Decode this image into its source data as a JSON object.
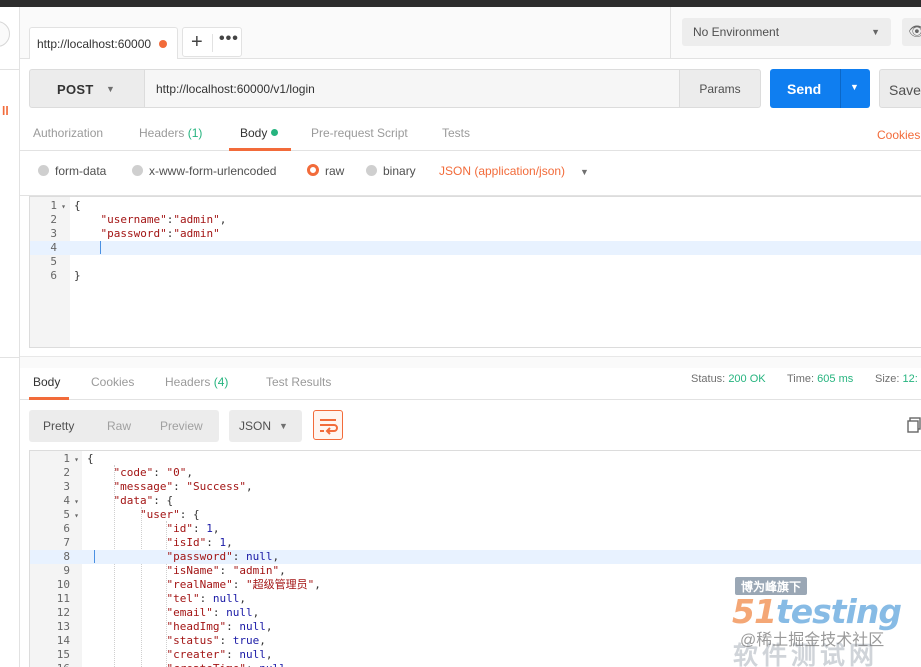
{
  "tabs": {
    "request_tab_label": "http://localhost:60000",
    "plus_label": "+",
    "more_label": "•••"
  },
  "environment": {
    "selected": "No Environment"
  },
  "request": {
    "method": "POST",
    "url": "http://localhost:60000/v1/login",
    "params_label": "Params",
    "send_label": "Send",
    "save_label": "Save"
  },
  "request_tabs": {
    "authorization": "Authorization",
    "headers": "Headers",
    "headers_count": "(1)",
    "body": "Body",
    "pre_request": "Pre-request Script",
    "tests": "Tests",
    "cookies": "Cookies"
  },
  "body_types": {
    "form_data": "form-data",
    "urlencoded": "x-www-form-urlencoded",
    "raw": "raw",
    "binary": "binary",
    "content_type": "JSON (application/json)"
  },
  "request_body_lines": [
    {
      "n": "1",
      "fold": "▾",
      "text": "{"
    },
    {
      "n": "2",
      "fold": "",
      "text": "    \"username\":\"admin\","
    },
    {
      "n": "3",
      "fold": "",
      "text": "    \"password\":\"admin\""
    },
    {
      "n": "4",
      "fold": "",
      "text": "    "
    },
    {
      "n": "5",
      "fold": "",
      "text": ""
    },
    {
      "n": "6",
      "fold": "",
      "text": "}"
    }
  ],
  "response_tabs": {
    "body": "Body",
    "cookies": "Cookies",
    "headers": "Headers",
    "headers_count": "(4)",
    "test_results": "Test Results"
  },
  "response_meta": {
    "status_label": "Status:",
    "status_value": "200 OK",
    "time_label": "Time:",
    "time_value": "605 ms",
    "size_label": "Size:",
    "size_value": "12:"
  },
  "response_toolbar": {
    "pretty": "Pretty",
    "raw": "Raw",
    "preview": "Preview",
    "format": "JSON"
  },
  "response_body_lines": [
    {
      "n": "1",
      "fold": "▾",
      "indent": 0,
      "key": "",
      "val": "",
      "raw": "{"
    },
    {
      "n": "2",
      "fold": "",
      "indent": 1,
      "key": "\"code\"",
      "val": "\"0\"",
      "tail": ","
    },
    {
      "n": "3",
      "fold": "",
      "indent": 1,
      "key": "\"message\"",
      "val": "\"Success\"",
      "tail": ","
    },
    {
      "n": "4",
      "fold": "▾",
      "indent": 1,
      "key": "\"data\"",
      "val": "",
      "tail": "{"
    },
    {
      "n": "5",
      "fold": "▾",
      "indent": 2,
      "key": "\"user\"",
      "val": "",
      "tail": "{"
    },
    {
      "n": "6",
      "fold": "",
      "indent": 3,
      "key": "\"id\"",
      "val": "1",
      "tail": ","
    },
    {
      "n": "7",
      "fold": "",
      "indent": 3,
      "key": "\"isId\"",
      "val": "1",
      "tail": ","
    },
    {
      "n": "8",
      "fold": "",
      "indent": 3,
      "key": "\"password\"",
      "val": "null",
      "tail": ","
    },
    {
      "n": "9",
      "fold": "",
      "indent": 3,
      "key": "\"isName\"",
      "val": "\"admin\"",
      "tail": ","
    },
    {
      "n": "10",
      "fold": "",
      "indent": 3,
      "key": "\"realName\"",
      "val": "\"超级管理员\"",
      "tail": ","
    },
    {
      "n": "11",
      "fold": "",
      "indent": 3,
      "key": "\"tel\"",
      "val": "null",
      "tail": ","
    },
    {
      "n": "12",
      "fold": "",
      "indent": 3,
      "key": "\"email\"",
      "val": "null",
      "tail": ","
    },
    {
      "n": "13",
      "fold": "",
      "indent": 3,
      "key": "\"headImg\"",
      "val": "null",
      "tail": ","
    },
    {
      "n": "14",
      "fold": "",
      "indent": 3,
      "key": "\"status\"",
      "val": "true",
      "tail": ","
    },
    {
      "n": "15",
      "fold": "",
      "indent": 3,
      "key": "\"creater\"",
      "val": "null",
      "tail": ","
    },
    {
      "n": "16",
      "fold": "",
      "indent": 3,
      "key": "\"createTime\"",
      "val": "null",
      "tail": ","
    }
  ],
  "watermark": {
    "badge": "博为峰旗下",
    "logo_num": "51",
    "logo_text": "testing",
    "community": "@稀土掘金技术社区",
    "cn_name": "软件测试网"
  },
  "colors": {
    "accent": "#f26b3a",
    "send_blue": "#0f7ef0",
    "success_green": "#26b47f"
  }
}
